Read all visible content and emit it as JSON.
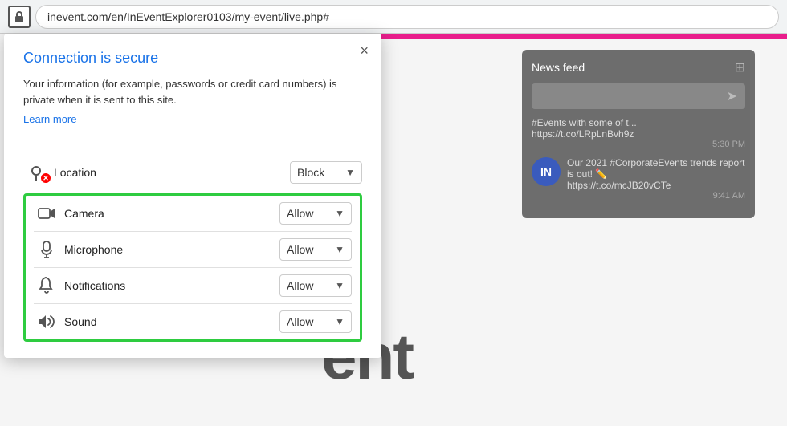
{
  "browser": {
    "url": "inevent.com/en/InEventExplorer0103/my-event/live.php#",
    "lock_icon": "🔒"
  },
  "popup": {
    "title": "Connection is secure",
    "description": "Your information (for example, passwords or credit card numbers) is private when it is sent to this site.",
    "learn_more": "Learn more",
    "close_label": "×"
  },
  "permissions": {
    "location": {
      "label": "Location",
      "value": "Block",
      "icon": "📍"
    },
    "camera": {
      "label": "Camera",
      "value": "Allow",
      "icon": "🎥"
    },
    "microphone": {
      "label": "Microphone",
      "value": "Allow",
      "icon": "🎤"
    },
    "notifications": {
      "label": "Notifications",
      "value": "Allow",
      "icon": "🔔"
    },
    "sound": {
      "label": "Sound",
      "value": "Allow",
      "icon": "🔊"
    }
  },
  "news_feed": {
    "title": "News feed",
    "items": [
      {
        "text": "#Events with some of t...\nhttps://t.co/LRpLnBvh9z",
        "time": "5:30 PM"
      },
      {
        "text": "Our 2021 #CorporateEvents trends report is out! 🖊\nhttps://t.co/mcJB20vCTe",
        "time": "9:41 AM",
        "has_avatar": true,
        "avatar_text": "IN"
      }
    ]
  },
  "background": {
    "large_text": "ent"
  }
}
